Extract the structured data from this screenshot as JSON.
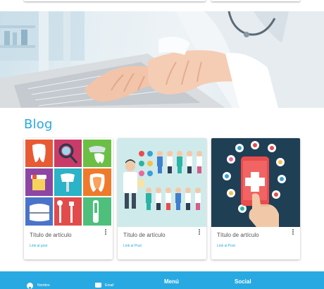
{
  "hero": {
    "image_alt": ""
  },
  "blog": {
    "heading": "Blog",
    "cards": [
      {
        "title": "Título de artículo",
        "link": "Link al post"
      },
      {
        "title": "Título de artículo",
        "link": "Link al Post"
      },
      {
        "title": "Título de artículo",
        "link": "Link al Post"
      }
    ]
  },
  "footer": {
    "name_placeholder": "Nombre",
    "email_placeholder": "Email",
    "menu_heading": "Menú",
    "social_heading": "Social",
    "icons": [
      "user-icon",
      "mail-icon"
    ]
  },
  "colors": {
    "accent": "#29a9e1",
    "footer_bg": "#29a9e1"
  }
}
